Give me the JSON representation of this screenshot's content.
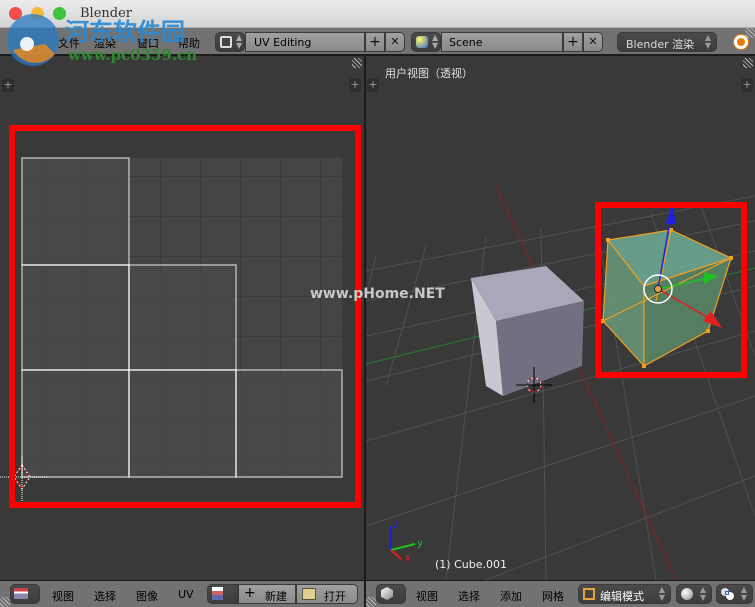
{
  "window": {
    "title": "Blender"
  },
  "watermarks": {
    "site_name": "河东软件园",
    "site_url": "www.pc0359.cn",
    "overlay": "www.pHome.NET"
  },
  "topbar": {
    "menu": [
      "文件",
      "渲染",
      "窗口",
      "帮助"
    ],
    "layout": {
      "value": "UV Editing",
      "icon": "screen-layout-icon"
    },
    "scene": {
      "value": "Scene",
      "icon": "scene-icon"
    },
    "add_label": "+",
    "remove_label": "✕",
    "render_engine": {
      "value": "Blender 渲染"
    }
  },
  "uv_editor": {
    "header": {
      "menu": [
        "视图",
        "选择",
        "图像",
        "UV"
      ],
      "new_label": "新建",
      "open_label": "打开"
    }
  },
  "viewport": {
    "view_label": "用户视图（透视）",
    "object_label": "(1) Cube.001",
    "header": {
      "menu": [
        "视图",
        "选择",
        "添加",
        "网格"
      ],
      "mode": "编辑模式"
    },
    "axes": {
      "x": "x",
      "y": "y",
      "z": "z"
    }
  },
  "colors": {
    "highlight": "#ff0000",
    "selected_edge": "#f0a020",
    "selected_face": "#7fb39a",
    "x_axis": "#e02020",
    "y_axis": "#20c020",
    "z_axis": "#2020e0"
  }
}
